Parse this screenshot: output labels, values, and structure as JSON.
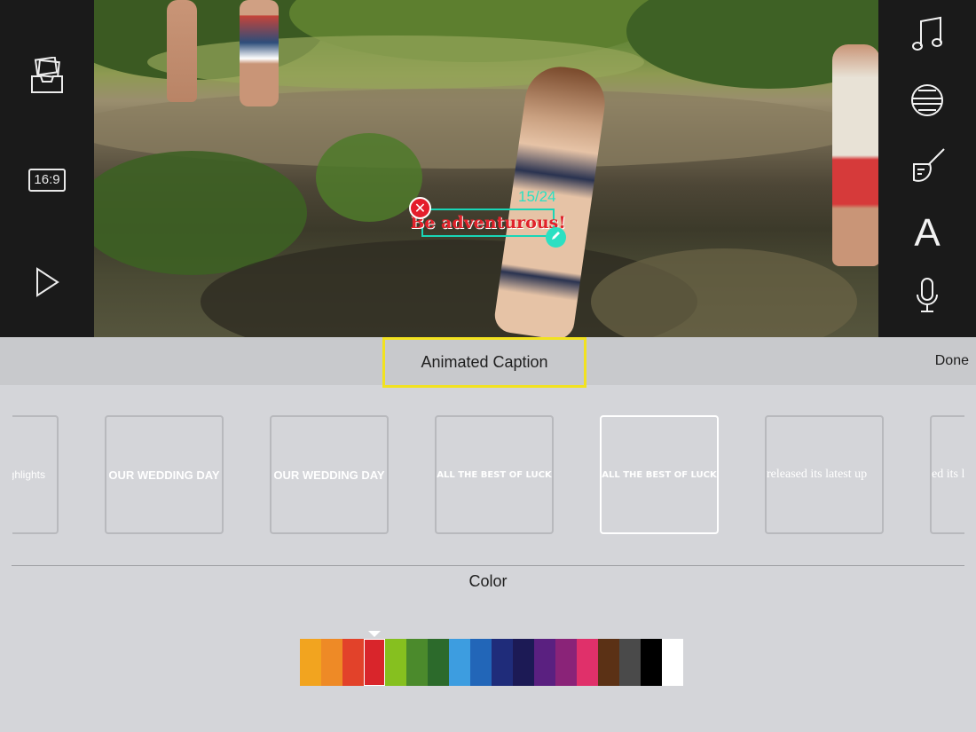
{
  "toolbar_left": {
    "media_icon": "photo-inbox-icon",
    "aspect_ratio": "16:9",
    "play_icon": "play-icon"
  },
  "toolbar_right": {
    "music_icon": "music-note-icon",
    "theme_icon": "theme-icon",
    "filter_icon": "brush-icon",
    "text_icon_glyph": "A",
    "voice_icon": "microphone-icon"
  },
  "preview": {
    "caption_text": "Be adventurous!",
    "char_count": "15/24",
    "caption_color": "#e0222b",
    "handle_color": "#2ce0c2"
  },
  "header": {
    "title": "Animated Caption",
    "done_label": "Done",
    "highlight_color": "#f2e21f"
  },
  "styles": {
    "tiles": [
      {
        "label": "ighlights",
        "style": "sans"
      },
      {
        "label": "OUR WEDDING DAY",
        "style": "sans"
      },
      {
        "label": "OUR WEDDING DAY",
        "style": "sans"
      },
      {
        "label": "ALL THE BEST OF LUCK",
        "style": "small"
      },
      {
        "label": "ALL THE BEST OF LUCK",
        "style": "small",
        "selected": true
      },
      {
        "label": "released its latest up",
        "style": "serif"
      },
      {
        "label": "ed its l",
        "style": "serif"
      }
    ]
  },
  "color_section": {
    "label": "Color",
    "selected_index": 3,
    "swatches": [
      "#f2a41f",
      "#ee8a26",
      "#e2422a",
      "#d9252b",
      "#86c01f",
      "#4b8a2c",
      "#2c6a2b",
      "#3d9de0",
      "#2266b8",
      "#1f2c7a",
      "#1c1a55",
      "#5a2080",
      "#8a2378",
      "#e0306a",
      "#5b3115",
      "#4a4a4a",
      "#000000",
      "#ffffff"
    ]
  }
}
